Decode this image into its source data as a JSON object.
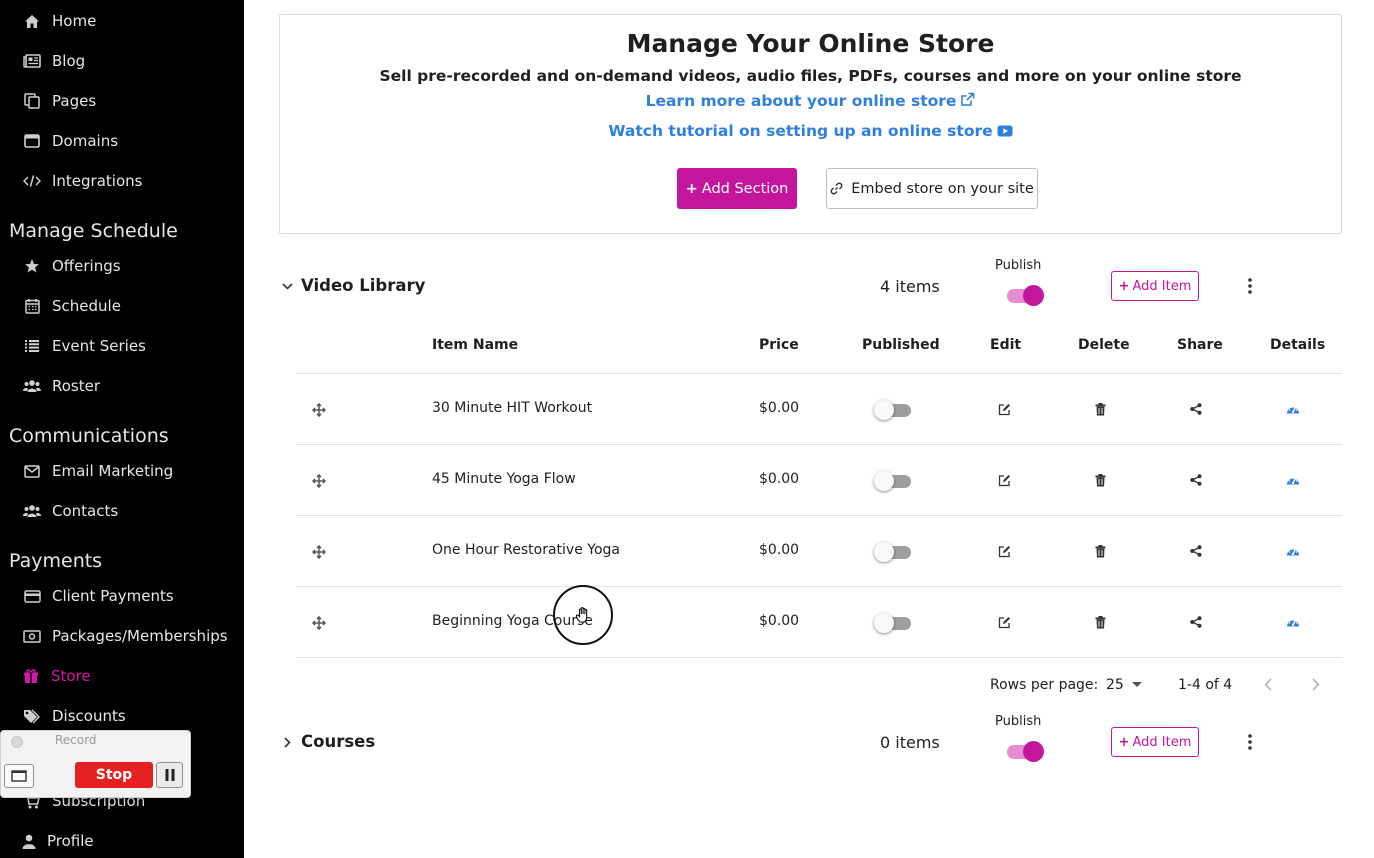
{
  "sidebar": {
    "items_top": [
      {
        "label": "Home",
        "icon": "home-icon"
      },
      {
        "label": "Blog",
        "icon": "newspaper-icon"
      },
      {
        "label": "Pages",
        "icon": "pages-icon"
      },
      {
        "label": "Domains",
        "icon": "window-icon"
      },
      {
        "label": "Integrations",
        "icon": "code-icon"
      }
    ],
    "sections": [
      {
        "heading": "Manage Schedule",
        "items": [
          {
            "label": "Offerings",
            "icon": "star-icon"
          },
          {
            "label": "Schedule",
            "icon": "calendar-icon"
          },
          {
            "label": "Event Series",
            "icon": "list-icon"
          },
          {
            "label": "Roster",
            "icon": "users-icon"
          }
        ]
      },
      {
        "heading": "Communications",
        "items": [
          {
            "label": "Email Marketing",
            "icon": "envelope-icon"
          },
          {
            "label": "Contacts",
            "icon": "users-icon"
          }
        ]
      },
      {
        "heading": "Payments",
        "items": [
          {
            "label": "Client Payments",
            "icon": "credit-card-icon"
          },
          {
            "label": "Packages/Memberships",
            "icon": "money-icon"
          },
          {
            "label": "Store",
            "icon": "gift-icon"
          },
          {
            "label": "Discounts",
            "icon": "tags-icon"
          },
          {
            "label": "Subscription",
            "icon": "cart-icon"
          },
          {
            "label": "Profile",
            "icon": "user-icon"
          }
        ]
      }
    ],
    "active": "Store",
    "accent_color": "#d21aa9"
  },
  "recorder": {
    "title": "Record",
    "stop_label": "Stop"
  },
  "store_card": {
    "title": "Manage Your Online Store",
    "subtitle": "Sell pre-recorded and on-demand videos, audio files, PDFs, courses and more on your online store",
    "learn_more_link": "Learn more about your online store",
    "tutorial_link": "Watch tutorial on setting up an online store",
    "add_section_label": "Add Section",
    "embed_label": "Embed store on your site",
    "brand_color": "#c4169c",
    "link_color": "#2f7fe0"
  },
  "sections": [
    {
      "title": "Video Library",
      "count": "4 items",
      "publish_label": "Publish",
      "published": true,
      "add_item_label": "Add Item",
      "expanded": true
    },
    {
      "title": "Courses",
      "count": "0 items",
      "publish_label": "Publish",
      "published": true,
      "add_item_label": "Add Item",
      "expanded": false
    }
  ],
  "table": {
    "columns": [
      "Item Name",
      "Price",
      "Published",
      "Edit",
      "Delete",
      "Share",
      "Details"
    ],
    "rows": [
      {
        "name": "30 Minute HIT Workout",
        "price": "$0.00",
        "published": false
      },
      {
        "name": "45 Minute Yoga Flow",
        "price": "$0.00",
        "published": false
      },
      {
        "name": "One Hour Restorative Yoga",
        "price": "$0.00",
        "published": false
      },
      {
        "name": "Beginning Yoga Course",
        "price": "$0.00",
        "published": false
      }
    ]
  },
  "pagination": {
    "rows_per_page_label": "Rows per page:",
    "rows_per_page": "25",
    "range": "1-4 of 4"
  }
}
